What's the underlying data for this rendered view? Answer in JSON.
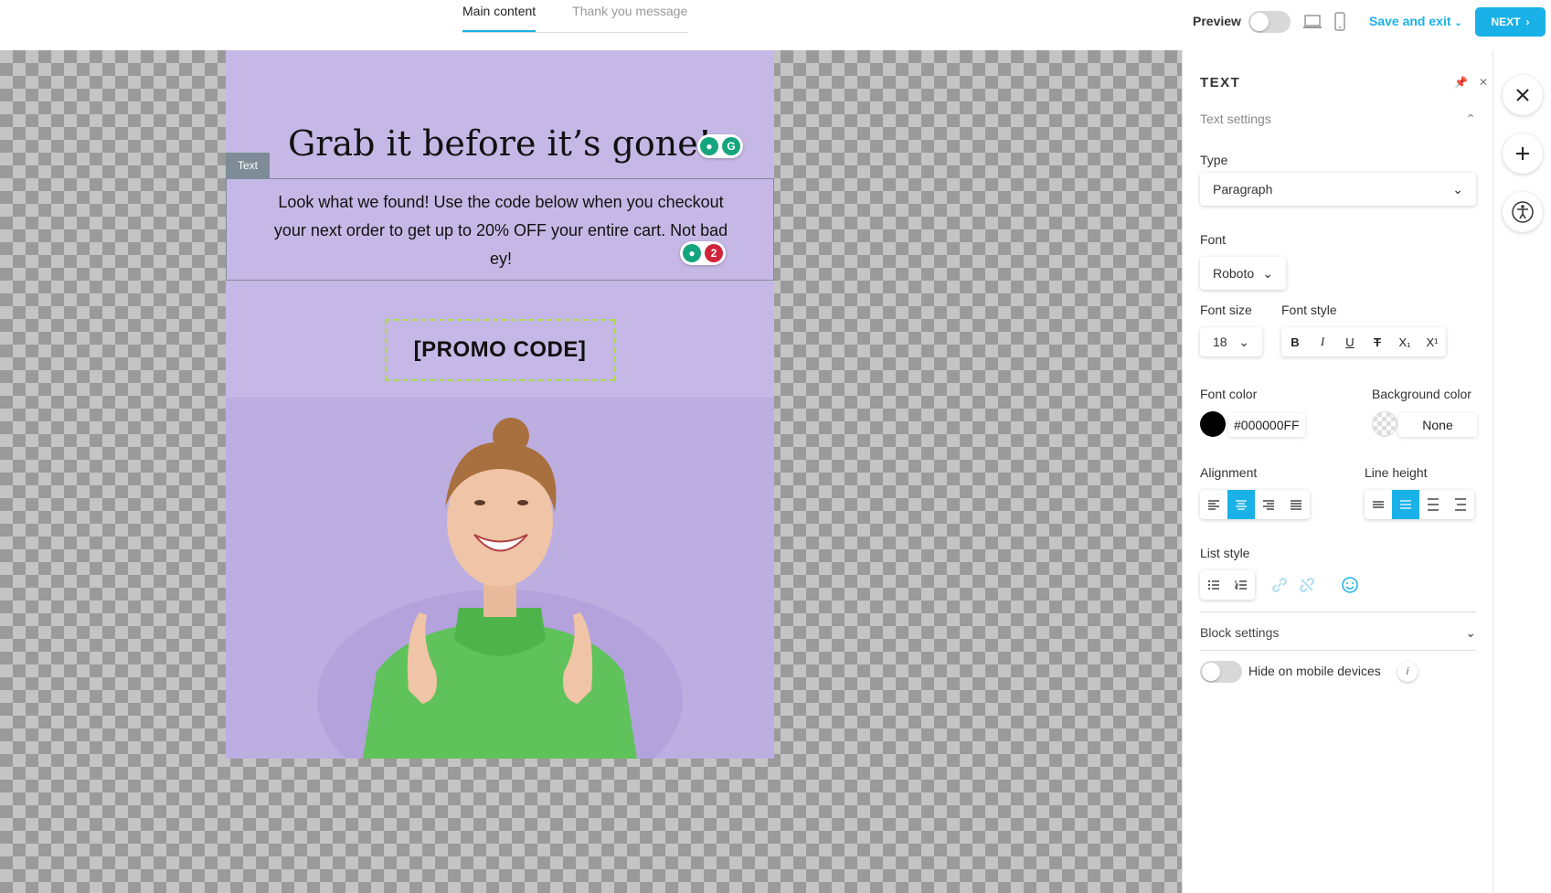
{
  "tabs": [
    {
      "label": "Main content",
      "active": true
    },
    {
      "label": "Thank you message",
      "active": false
    }
  ],
  "header": {
    "preview_label": "Preview",
    "save_exit_label": "Save and exit",
    "next_label": "NEXT"
  },
  "popup": {
    "headline": "Grab it before it’s gone!",
    "block_tag": "Text",
    "body_text": "Look what we found! Use the code below when you checkout your next order to get up to 20% OFF your entire cart. Not bad ey!",
    "grammar_badge_count": "2",
    "promo_text": "[PROMO CODE]",
    "background_color": "#c6b8e6"
  },
  "panel": {
    "title": "TEXT",
    "text_settings_label": "Text settings",
    "type_label": "Type",
    "type_value": "Paragraph",
    "font_label": "Font",
    "font_value": "Roboto",
    "font_size_label": "Font size",
    "font_size_value": "18",
    "font_style_label": "Font style",
    "font_style_buttons": [
      "B",
      "I",
      "U",
      "T",
      "X₁",
      "X¹"
    ],
    "font_color_label": "Font color",
    "font_color_value": "#000000FF",
    "bg_color_label": "Background color",
    "bg_color_value": "None",
    "alignment_label": "Alignment",
    "alignment_selected": "center",
    "line_height_label": "Line height",
    "list_style_label": "List style",
    "block_settings_label": "Block settings",
    "hide_mobile_label": "Hide on mobile devices",
    "info_glyph": "i"
  },
  "colors": {
    "accent": "#19b1e7",
    "canvas_check": "#9a9a9a",
    "promo_border": "#a8d84a"
  }
}
